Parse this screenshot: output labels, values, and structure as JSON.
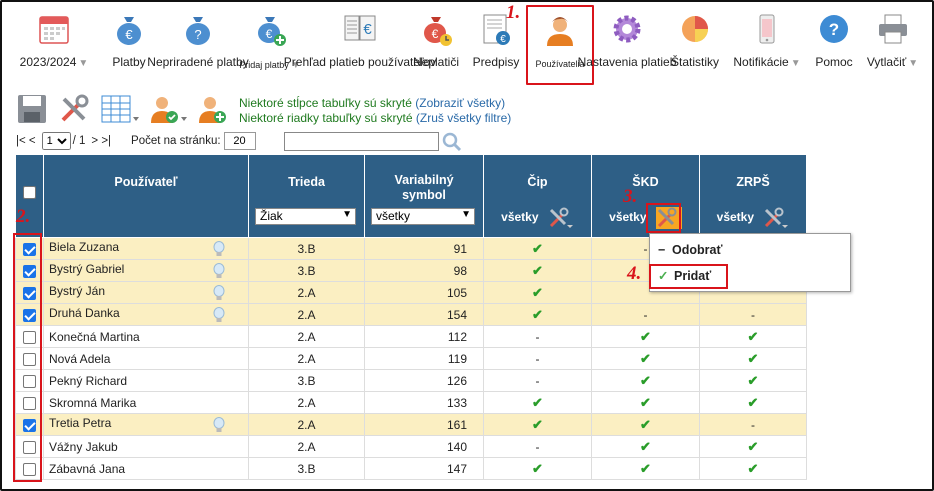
{
  "menu": {
    "items": [
      {
        "label": "2023/2024",
        "icon": "calendar-icon",
        "has_caret": true
      },
      {
        "label": "Platby",
        "icon": "money-bag-icon"
      },
      {
        "label": "Nepriradené platby",
        "icon": "money-bag-question-icon"
      },
      {
        "label": "Pridaj platby",
        "icon": "money-bag-add-icon",
        "has_caret": true
      },
      {
        "label": "Prehľad platieb používateľov",
        "icon": "ledger-euro-icon"
      },
      {
        "label": "Neplatiči",
        "icon": "money-bag-clock-icon"
      },
      {
        "label": "Predpisy",
        "icon": "document-euro-icon"
      },
      {
        "label": "Používatelia",
        "icon": "user-icon",
        "active": true
      },
      {
        "label": "Nastavenia platieb",
        "icon": "gear-icon"
      },
      {
        "label": "Štatistiky",
        "icon": "pie-chart-icon"
      },
      {
        "label": "Notifikácie",
        "icon": "phone-icon",
        "has_caret": true
      },
      {
        "label": "Pomoc",
        "icon": "help-icon"
      },
      {
        "label": "Vytlačiť",
        "icon": "printer-icon",
        "has_caret": true
      }
    ]
  },
  "annotations": {
    "a1": "1.",
    "a2": "2.",
    "a3": "3.",
    "a4": "4."
  },
  "notes": {
    "hidden_cols": "Niektoré stĺpce tabuľky sú skryté",
    "show_all": "(Zobraziť všetky)",
    "hidden_rows": "Niektoré riadky tabuľky sú skryté",
    "cancel_filters": "(Zruš všetky filtre)"
  },
  "pager": {
    "first": "|< <",
    "page": "1",
    "of": "/ 1",
    "next": "> >|",
    "per_page_label": "Počet na stránku:",
    "per_page": "20"
  },
  "table": {
    "headers": {
      "user": "Používateľ",
      "class": "Trieda",
      "vs": "Variabilný symbol",
      "chip": "Čip",
      "skd": "ŠKD",
      "zrps": "ZRPŠ"
    },
    "filters": {
      "class": "Žiak",
      "vs": "všetky",
      "chip": "všetky",
      "skd": "všetky",
      "zrps": "všetky"
    },
    "rows": [
      {
        "name": "Biela Zuzana",
        "class": "3.B",
        "vs": "91",
        "checked": true,
        "bulb": true,
        "chip": "ok",
        "skd": "-",
        "zrps": ""
      },
      {
        "name": "Bystrý Gabriel",
        "class": "3.B",
        "vs": "98",
        "checked": true,
        "bulb": true,
        "chip": "ok",
        "skd": "",
        "zrps": ""
      },
      {
        "name": "Bystrý Ján",
        "class": "2.A",
        "vs": "105",
        "checked": true,
        "bulb": true,
        "chip": "ok",
        "skd": "",
        "zrps": ""
      },
      {
        "name": "Druhá Danka",
        "class": "2.A",
        "vs": "154",
        "checked": true,
        "bulb": true,
        "chip": "ok",
        "skd": "-",
        "zrps": "-"
      },
      {
        "name": "Konečná Martina",
        "class": "2.A",
        "vs": "112",
        "checked": false,
        "bulb": false,
        "chip": "-",
        "skd": "ok",
        "zrps": "ok"
      },
      {
        "name": "Nová Adela",
        "class": "2.A",
        "vs": "119",
        "checked": false,
        "bulb": false,
        "chip": "-",
        "skd": "ok",
        "zrps": "ok"
      },
      {
        "name": "Pekný Richard",
        "class": "3.B",
        "vs": "126",
        "checked": false,
        "bulb": false,
        "chip": "-",
        "skd": "ok",
        "zrps": "ok"
      },
      {
        "name": "Skromná Marika",
        "class": "2.A",
        "vs": "133",
        "checked": false,
        "bulb": false,
        "chip": "ok",
        "skd": "ok",
        "zrps": "ok"
      },
      {
        "name": "Tretia Petra",
        "class": "2.A",
        "vs": "161",
        "checked": true,
        "bulb": true,
        "chip": "ok",
        "skd": "ok",
        "zrps": "-"
      },
      {
        "name": "Vážny Jakub",
        "class": "2.A",
        "vs": "140",
        "checked": false,
        "bulb": false,
        "chip": "-",
        "skd": "ok",
        "zrps": "ok"
      },
      {
        "name": "Zábavná Jana",
        "class": "3.B",
        "vs": "147",
        "checked": false,
        "bulb": false,
        "chip": "ok",
        "skd": "ok",
        "zrps": "ok"
      }
    ]
  },
  "popup": {
    "remove": "Odobrať",
    "add": "Pridať"
  },
  "colors": {
    "header_bg": "#2e5f86",
    "highlight_row": "#fbefc2",
    "annotation_red": "#d9141b",
    "check_green": "#2a9d2a"
  }
}
